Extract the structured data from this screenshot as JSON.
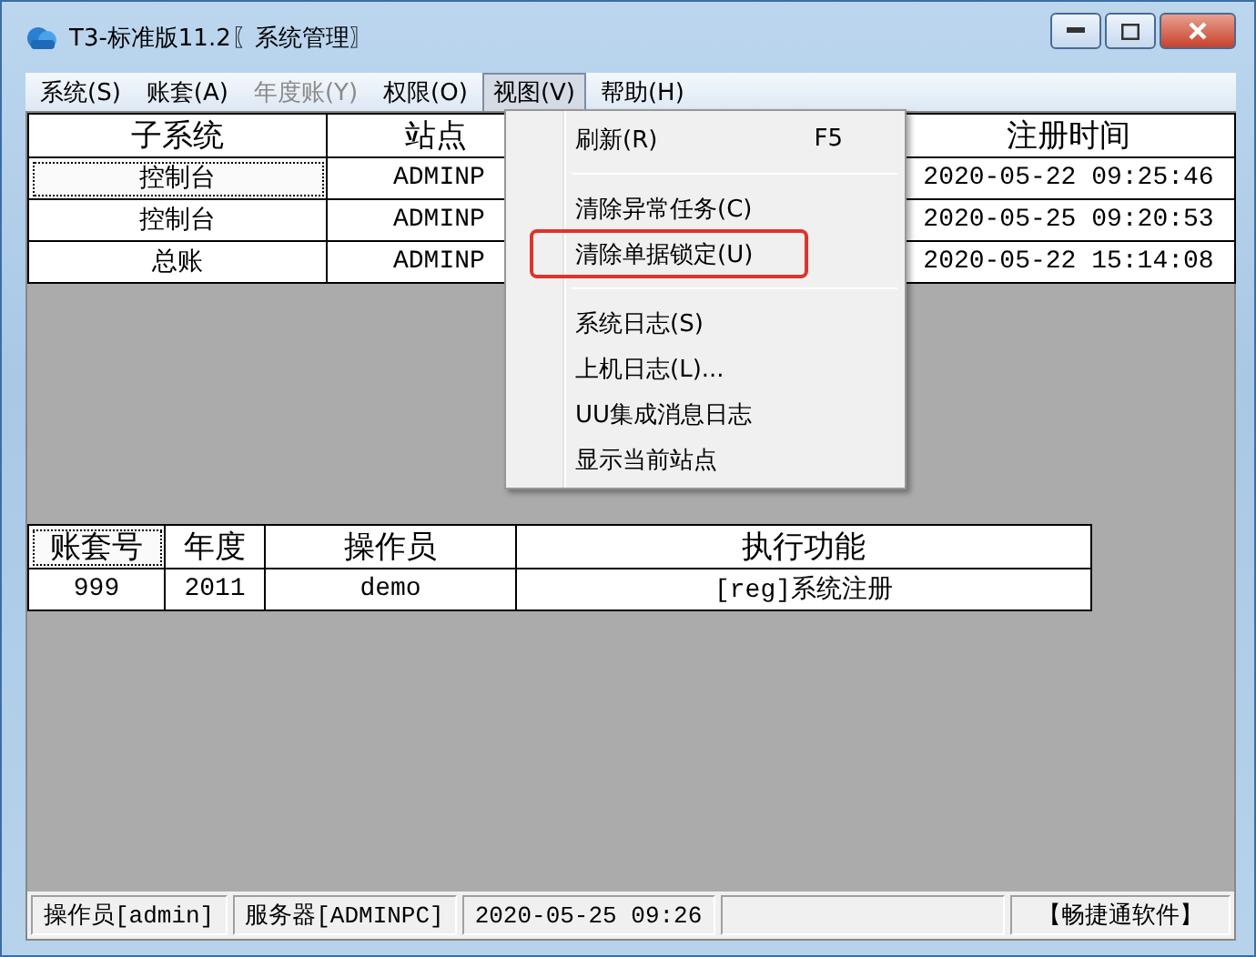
{
  "window": {
    "title": "T3-标准版11.2〖系统管理〗"
  },
  "menu_bar": [
    {
      "label": "系统(S)",
      "selected": false,
      "disabled": false
    },
    {
      "label": "账套(A)",
      "selected": false,
      "disabled": false
    },
    {
      "label": "年度账(Y)",
      "selected": false,
      "disabled": true
    },
    {
      "label": "权限(O)",
      "selected": false,
      "disabled": false
    },
    {
      "label": "视图(V)",
      "selected": true,
      "disabled": false
    },
    {
      "label": "帮助(H)",
      "selected": false,
      "disabled": false
    }
  ],
  "dropdown_menu": {
    "items": [
      {
        "kind": "item",
        "label": "刷新(R)",
        "shortcut": "F5",
        "highlighted": false
      },
      {
        "kind": "separator"
      },
      {
        "kind": "item",
        "label": "清除异常任务(C)",
        "highlighted": false
      },
      {
        "kind": "item",
        "label": "清除单据锁定(U)",
        "highlighted": true
      },
      {
        "kind": "separator"
      },
      {
        "kind": "item",
        "label": "系统日志(S)",
        "highlighted": false
      },
      {
        "kind": "item",
        "label": "上机日志(L)...",
        "highlighted": false
      },
      {
        "kind": "item",
        "label": "UU集成消息日志",
        "highlighted": false
      },
      {
        "kind": "item",
        "label": "显示当前站点",
        "highlighted": false
      }
    ]
  },
  "subsystem_table": {
    "columns": [
      "子系统",
      "站点",
      "注册时间"
    ],
    "rows": [
      {
        "cells": [
          "控制台",
          "ADMINP",
          "2020-05-22 09:25:46"
        ],
        "focused": true
      },
      {
        "cells": [
          "控制台",
          "ADMINP",
          "2020-05-25 09:20:53"
        ],
        "focused": false
      },
      {
        "cells": [
          "总账",
          "ADMINP",
          "2020-05-22 15:14:08"
        ],
        "focused": false
      }
    ]
  },
  "task_table": {
    "columns": [
      {
        "label": "账套号",
        "focused": true
      },
      {
        "label": "年度",
        "focused": false
      },
      {
        "label": "操作员",
        "focused": false
      },
      {
        "label": "执行功能",
        "focused": false
      }
    ],
    "rows": [
      [
        "999",
        "2011",
        "demo",
        "[reg]系统注册"
      ]
    ]
  },
  "status_bar": [
    "操作员[admin]",
    "服务器[ADMINPC]",
    "2020-05-25 09:26",
    "【畅捷通软件】"
  ]
}
